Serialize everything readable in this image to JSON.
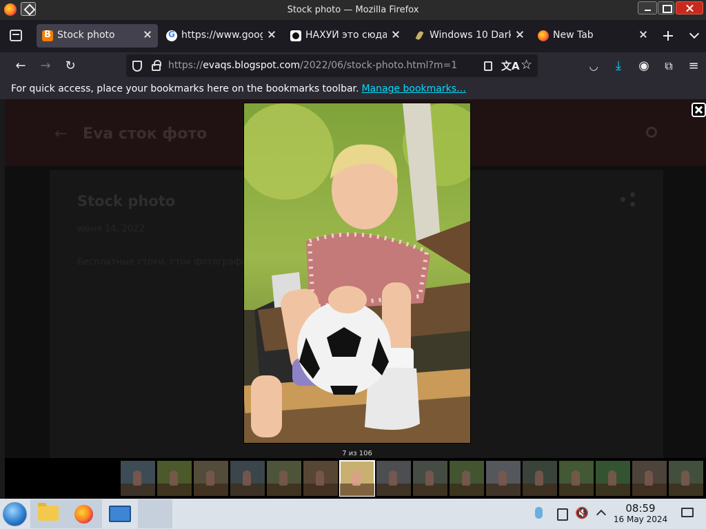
{
  "window": {
    "title": "Stock photo — Mozilla Firefox"
  },
  "tabs": [
    {
      "label": "Stock photo",
      "favicon": "blogger-icon",
      "active": true
    },
    {
      "label": "https://www.google.",
      "favicon": "google-icon",
      "active": false
    },
    {
      "label": "НАХУЙ это сюда",
      "favicon": "dark-site-icon",
      "active": false
    },
    {
      "label": "Windows 10 Dark",
      "favicon": "leaf-icon",
      "active": false
    },
    {
      "label": "New Tab",
      "favicon": "firefox-icon",
      "active": false
    }
  ],
  "urlbar": {
    "scheme": "https://",
    "host": "evaqs.blogspot.com",
    "path": "/2022/06/stock-photo.html?m=1"
  },
  "bookmarks_bar": {
    "message": "For quick access, place your bookmarks here on the bookmarks toolbar.",
    "link": "Manage bookmarks…"
  },
  "page": {
    "blog_title": "Eva сток фото",
    "post_title": "Stock photo",
    "post_date": "июня 14, 2022",
    "snippet": "Бесплатные стоки, сток фотографии"
  },
  "lightbox": {
    "counter": "7 из 106",
    "thumbnail_count": 16,
    "selected_index": 6,
    "photo_subject": "boy-with-soccer-ball-photo"
  },
  "taskbar": {
    "time": "08:59",
    "date": "16 May 2024"
  },
  "colors": {
    "firefox_tab_bg": "#1c1b22",
    "firefox_toolbar": "#2b2a33",
    "link_accent": "#00ddff",
    "taskbar_bg": "#dbe2ea"
  }
}
